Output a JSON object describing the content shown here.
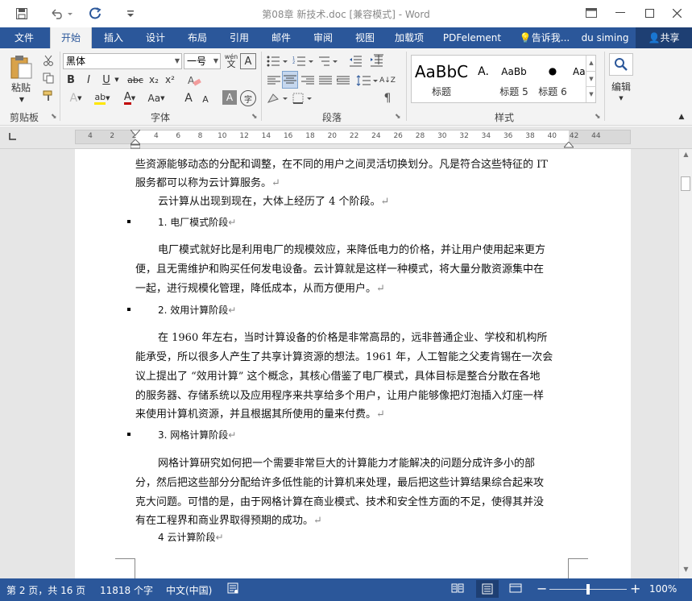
{
  "window": {
    "title": "第08章 新技术.doc [兼容模式] - Word",
    "icons": [
      "save-icon",
      "undo-icon",
      "redo-icon",
      "customize-icon",
      "ribbon-display-icon",
      "minimize-icon",
      "maximize-icon",
      "close-icon"
    ]
  },
  "tabs": [
    "文件",
    "开始",
    "插入",
    "设计",
    "布局",
    "引用",
    "邮件",
    "审阅",
    "视图",
    "加载项",
    "PDFelement"
  ],
  "tell_me": "告诉我...",
  "user": "du siming",
  "share": "共享",
  "ribbon": {
    "clipboard": {
      "paste": "粘贴",
      "label": "剪贴板"
    },
    "font": {
      "name": "黑体",
      "size": "一号",
      "wen": "wén",
      "label": "字体",
      "buttons": {
        "bold": "B",
        "italic": "I",
        "underline": "U",
        "strike": "abc",
        "sub": "x₂",
        "sup": "x²",
        "enclosed": "A",
        "grow": "A",
        "shrink": "A",
        "aa": "Aa",
        "clear": "A",
        "highlight": "ab",
        "color": "A",
        "shade": "A",
        "char_border": "字"
      }
    },
    "paragraph": {
      "label": "段落",
      "sort": "A↓Z"
    },
    "styles": {
      "label": "样式",
      "items": [
        {
          "sample": "AaBbC",
          "name": "标题"
        },
        {
          "sample": "A.",
          "name": ""
        },
        {
          "sample": "AaBb",
          "name": "标题 5"
        },
        {
          "sample": "●",
          "name": "标题 6"
        },
        {
          "sample": "AaE",
          "name": ""
        }
      ]
    },
    "editing": {
      "label": "编辑"
    }
  },
  "ruler": {
    "ticks": [
      "4",
      "2",
      "2",
      "4",
      "6",
      "8",
      "10",
      "12",
      "14",
      "16",
      "18",
      "20",
      "22",
      "24",
      "26",
      "28",
      "30",
      "32",
      "34",
      "36",
      "38",
      "40",
      "42",
      "44"
    ]
  },
  "document": {
    "lines": [
      "些资源能够动态的分配和调整，在不同的用户之间灵活切换划分。凡是符合这些特征的 IT",
      "服务都可以称为云计算服务。",
      "云计算从出现到现在，大体上经历了 4 个阶段。",
      "1.  电厂模式阶段",
      "电厂模式就好比是利用电厂的规模效应，来降低电力的价格，并让用户使用起来更方",
      "便，且无需维护和购买任何发电设备。云计算就是这样一种模式，将大量分散资源集中在",
      "一起，进行规模化管理，降低成本，从而方便用户。",
      "2.  效用计算阶段",
      "在  1960  年左右，当时计算设备的价格是非常高昂的，远非普通企业、学校和机构所",
      "能承受，所以很多人产生了共享计算资源的想法。1961 年，人工智能之父麦肯锡在一次会",
      "议上提出了 “效用计算” 这个概念，其核心借鉴了电厂模式，具体目标是整合分散在各地",
      "的服务器、存储系统以及应用程序来共享给多个用户，让用户能够像把灯泡插入灯座一样",
      "来使用计算机资源，并且根据其所使用的量来付费。",
      "3.  网格计算阶段",
      "网格计算研究如何把一个需要非常巨大的计算能力才能解决的问题分成许多小的部",
      "分，然后把这些部分分配给许多低性能的计算机来处理，最后把这些计算结果综合起来攻",
      "克大问题。可惜的是，由于网格计算在商业模式、技术和安全性方面的不足，使得其并没",
      "有在工程界和商业界取得预期的成功。",
      "4  云计算阶段"
    ],
    "paragraph_mark": "↵"
  },
  "status": {
    "page": "第 2 页，共 16 页",
    "words": "11818 个字",
    "language": "中文(中国)",
    "zoom": "100%",
    "zoom_level": 1.0
  },
  "colors": {
    "accent": "#2b579a"
  }
}
